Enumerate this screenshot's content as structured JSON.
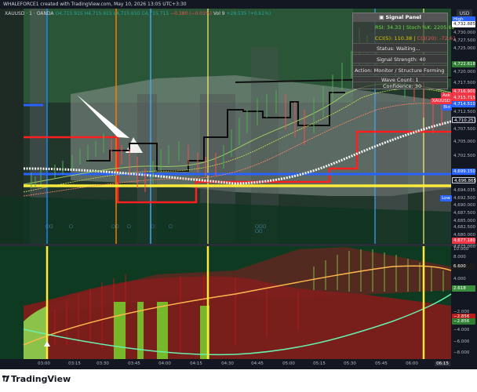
{
  "window": {
    "title": "WHALEFORCE1 created with TradingView.com, May 10, 2026 13:05 UTC+3:30",
    "currency_button": "USD"
  },
  "legend": {
    "symbol": "XAUUSD · 1 · OANDA",
    "open": "O4,715.915",
    "high": "H4,715.915",
    "low": "L4,715.650",
    "close": "C4,715.715",
    "change": "−0.380 (−0.01%)",
    "volume": "Vol 9",
    "delta": "+28.535 (+0.61%)"
  },
  "signal_panel": {
    "title": "Signal Panel",
    "rsi": "RSI: 34.33 | Stoch %K: 2205.62",
    "cci_pos": "CCI(5): 110.38 |",
    "cci_neg": "CCI(20): -72.61",
    "status": "Status: Waiting...",
    "strength": "Signal Strength: 40",
    "action": "Action: Monitor / Structure Forming",
    "wave": "Wave Count: 1",
    "confidence": "Confidence: 30"
  },
  "price_axis": {
    "labels": [
      {
        "text": "High",
        "fill": "#2962ff",
        "box": true
      },
      {
        "text": "4,732.885",
        "fill": "#131722",
        "box": false
      },
      {
        "text": "4,730.000",
        "fill": "",
        "box": false
      },
      {
        "text": "4,727.500",
        "fill": "",
        "box": false
      },
      {
        "text": "4,725.000",
        "fill": "",
        "box": false
      },
      {
        "text": "4,722.618",
        "fill": "#2e7d32",
        "box": true
      },
      {
        "text": "4,720.000",
        "fill": "",
        "box": false
      },
      {
        "text": "4,717.500",
        "fill": "",
        "box": false
      },
      {
        "text": "4,716.900",
        "fill": "#f23645",
        "box": true
      },
      {
        "text": "4,715.715",
        "fill": "#f23645",
        "box": true
      },
      {
        "text": "4,714.510",
        "fill": "#2962ff",
        "box": true
      },
      {
        "text": "4,712.500",
        "fill": "",
        "box": false
      },
      {
        "text": "4,710.251",
        "fill": "#131722",
        "box": true
      },
      {
        "text": "4,707.500",
        "fill": "",
        "box": false
      },
      {
        "text": "4,705.000",
        "fill": "",
        "box": false
      },
      {
        "text": "4,702.500",
        "fill": "",
        "box": false
      },
      {
        "text": "4,699.150",
        "fill": "#2962ff",
        "box": true
      },
      {
        "text": "4,696.865",
        "fill": "#131722",
        "box": true
      },
      {
        "text": "4,694.035",
        "fill": "",
        "box": false
      },
      {
        "text": "4,692.500",
        "fill": "",
        "box": false
      },
      {
        "text": "4,690.000",
        "fill": "",
        "box": false
      },
      {
        "text": "4,687.500",
        "fill": "",
        "box": false
      },
      {
        "text": "4,685.000",
        "fill": "",
        "box": false
      },
      {
        "text": "4,682.500",
        "fill": "",
        "box": false
      },
      {
        "text": "4,680.000",
        "fill": "",
        "box": false
      },
      {
        "text": "4,677.180",
        "fill": "#f23645",
        "box": true
      },
      {
        "text": "4,675.000",
        "fill": "",
        "box": false
      }
    ],
    "tags": {
      "ask": "Ask",
      "pair": "XAUUSD",
      "bid": "Bid",
      "low": "Low"
    }
  },
  "oscillator_axis": {
    "labels": [
      {
        "text": "10.000",
        "fill": ""
      },
      {
        "text": "8.000",
        "fill": ""
      },
      {
        "text": "6.600",
        "fill": "#1b1b1b"
      },
      {
        "text": "4.000",
        "fill": ""
      },
      {
        "text": "2.618",
        "fill": "#388e3c"
      },
      {
        "text": "−2.000",
        "fill": ""
      },
      {
        "text": "−2.856",
        "fill": "#b71c1c"
      },
      {
        "text": "−2.856",
        "fill": "#2e7d32"
      },
      {
        "text": "−4.000",
        "fill": ""
      },
      {
        "text": "−6.000",
        "fill": ""
      },
      {
        "text": "−8.000",
        "fill": ""
      }
    ]
  },
  "time_axis": {
    "labels": [
      "03:00",
      "03:15",
      "03:30",
      "03:45",
      "04:00",
      "04:15",
      "04:30",
      "04:45",
      "05:00",
      "05:15",
      "05:30",
      "05:45",
      "06:00",
      "06:15"
    ],
    "highlight": "06:15"
  },
  "footer": {
    "brand": "TradingView"
  }
}
